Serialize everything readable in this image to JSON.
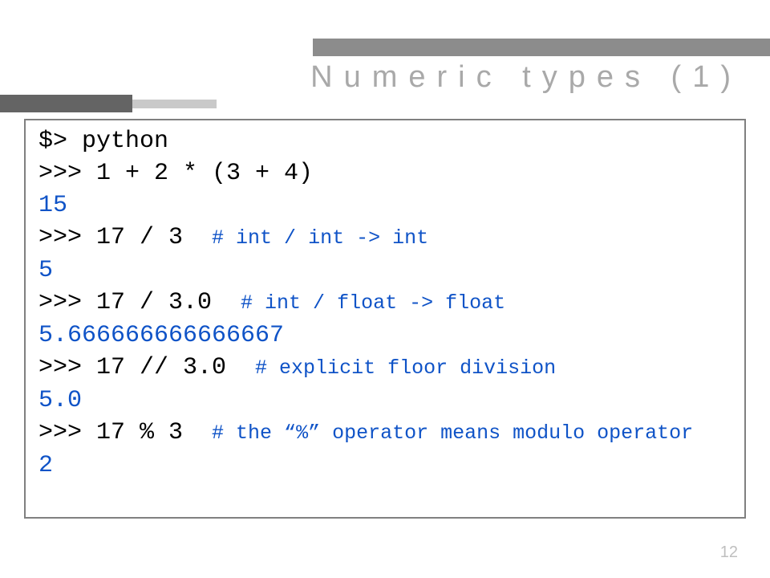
{
  "title": "Numeric types (1)",
  "page_number": "12",
  "code": {
    "l1": "$> python",
    "l2": ">>> 1 + 2 * (3 + 4)",
    "l3": "15",
    "l4_code": ">>> 17 / 3  ",
    "l4_comment": "# int / int -> int",
    "l5": "5",
    "l6_code": ">>> 17 / 3.0  ",
    "l6_comment": "# int / float -> float",
    "l7": "5.666666666666667",
    "l8_code": ">>> 17 // 3.0  ",
    "l8_comment": "# explicit floor division",
    "l9": "5.0",
    "l10_code": ">>> 17 % 3  ",
    "l10_comment": "# the “%” operator means modulo operator",
    "l11": "2"
  }
}
